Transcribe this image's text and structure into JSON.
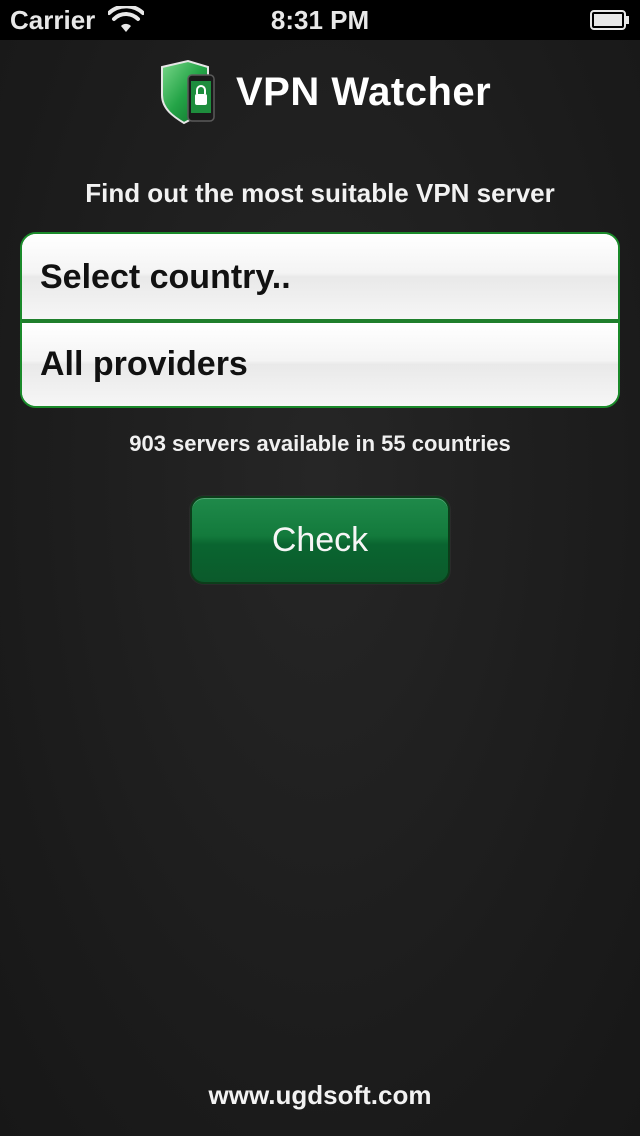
{
  "status_bar": {
    "carrier": "Carrier",
    "time": "8:31 PM",
    "wifi_icon": "wifi-icon",
    "battery_icon": "battery-icon"
  },
  "header": {
    "logo_icon": "shield-phone-lock-icon",
    "title": "VPN Watcher"
  },
  "subtitle": "Find out the most suitable VPN server",
  "selectors": {
    "country": "Select country..",
    "provider": "All providers"
  },
  "server_info": "903 servers available in 55 countries",
  "check_button": "Check",
  "footer_link": "www.ugdsoft.com",
  "colors": {
    "accent_green": "#137a3c",
    "border_green": "#1a8a2a",
    "background": "#1e1e1e"
  }
}
